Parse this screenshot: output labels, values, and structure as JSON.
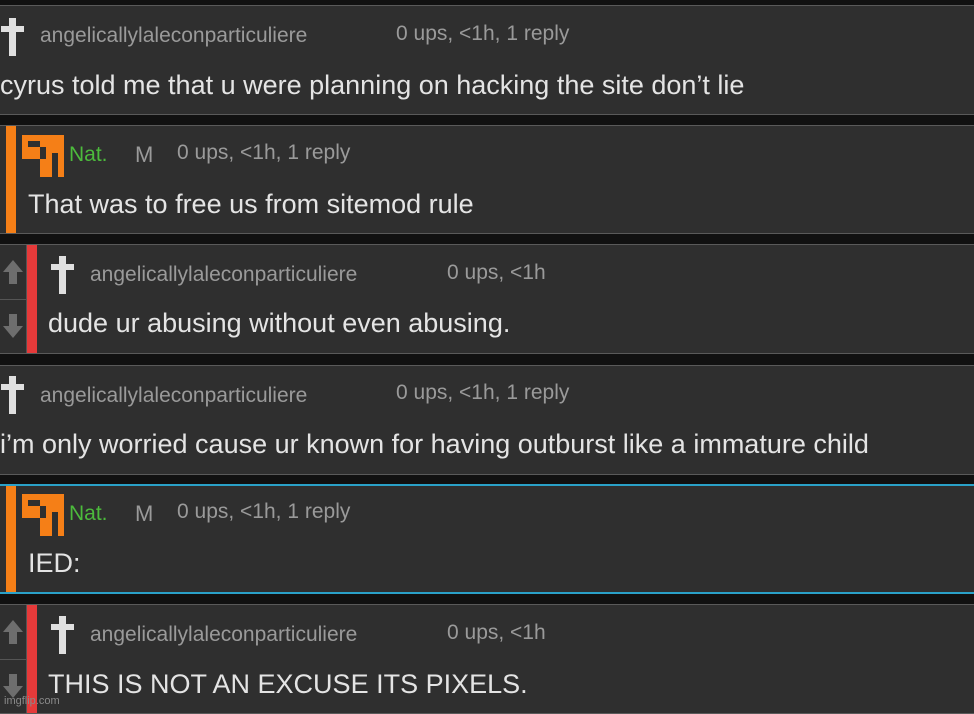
{
  "comments": [
    {
      "username": "angelicallylaleconparticuliere",
      "meta": "0 ups, <1h, 1 reply",
      "text": "cyrus told me that u were planning on hacking the site don’t lie",
      "avatar": "cross-icon"
    },
    {
      "username": "Nat.",
      "badge": "M",
      "meta": "0 ups, <1h, 1 reply",
      "text": "That was to free us from sitemod rule",
      "avatar": "orange-pixel-avatar",
      "bar_color": "#f57f17"
    },
    {
      "username": "angelicallylaleconparticuliere",
      "meta": "0 ups, <1h",
      "text": "dude ur abusing without even abusing.",
      "avatar": "cross-icon",
      "bar_color": "#e63a3a"
    },
    {
      "username": "angelicallylaleconparticuliere",
      "meta": "0 ups, <1h, 1 reply",
      "text": "i’m only worried cause ur known for having outburst like a immature child",
      "avatar": "cross-icon"
    },
    {
      "username": "Nat.",
      "badge": "M",
      "meta": "0 ups, <1h, 1 reply",
      "text": "IED:",
      "avatar": "orange-pixel-avatar",
      "bar_color": "#f57f17",
      "highlight_color": "#2aa1c8"
    },
    {
      "username": "angelicallylaleconparticuliere",
      "meta": "0 ups, <1h",
      "text": "THIS IS NOT AN EXCUSE ITS PIXELS.",
      "avatar": "cross-icon",
      "bar_color": "#e63a3a"
    }
  ],
  "watermark": "imgflip.com"
}
